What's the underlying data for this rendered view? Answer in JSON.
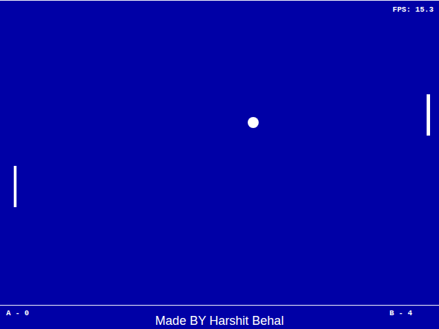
{
  "hud": {
    "fps": "FPS: 15.3"
  },
  "scores": {
    "a": "A - 0",
    "b": "B - 4"
  },
  "credit": "Made BY Harshit Behal"
}
